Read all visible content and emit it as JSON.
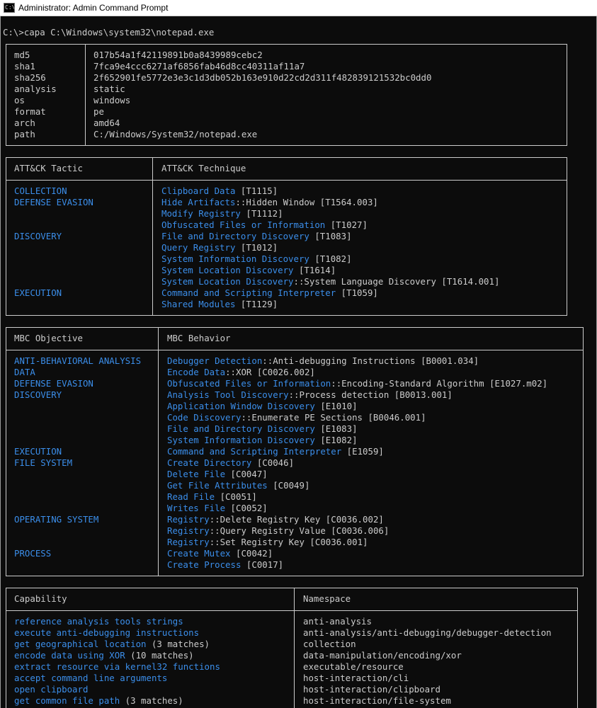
{
  "window": {
    "title": "Administrator: Admin Command Prompt",
    "icon_text": "C:\\"
  },
  "prompt": "C:\\>capa C:\\Windows\\system32\\notepad.exe",
  "colors": {
    "background": "#0c0c0c",
    "text": "#cccccc",
    "accent": "#3b8eea",
    "border": "#cccccc"
  },
  "meta": [
    {
      "key": "md5",
      "value": "017b54a1f42119891b0a8439989cebc2"
    },
    {
      "key": "sha1",
      "value": "7fca9e4ccc6271af6856fab46d8cc40311af11a7"
    },
    {
      "key": "sha256",
      "value": "2f652901fe5772e3e3c1d3db052b163e910d22cd2d311f482839121532bc0dd0"
    },
    {
      "key": "analysis",
      "value": "static"
    },
    {
      "key": "os",
      "value": "windows"
    },
    {
      "key": "format",
      "value": "pe"
    },
    {
      "key": "arch",
      "value": "amd64"
    },
    {
      "key": "path",
      "value": "C:/Windows/System32/notepad.exe"
    }
  ],
  "attack": {
    "headers": [
      "ATT&CK Tactic",
      "ATT&CK Technique"
    ],
    "rows": [
      {
        "left": "COLLECTION",
        "a": "Clipboard Data",
        "b": "",
        "c": " [T1115]"
      },
      {
        "left": "DEFENSE EVASION",
        "a": "Hide Artifacts",
        "b": "::Hidden Window",
        "c": " [T1564.003]"
      },
      {
        "left": "",
        "a": "Modify Registry",
        "b": "",
        "c": " [T1112]"
      },
      {
        "left": "",
        "a": "Obfuscated Files or Information",
        "b": "",
        "c": " [T1027]"
      },
      {
        "left": "DISCOVERY",
        "a": "File and Directory Discovery",
        "b": "",
        "c": " [T1083]"
      },
      {
        "left": "",
        "a": "Query Registry",
        "b": "",
        "c": " [T1012]"
      },
      {
        "left": "",
        "a": "System Information Discovery",
        "b": "",
        "c": " [T1082]"
      },
      {
        "left": "",
        "a": "System Location Discovery",
        "b": "",
        "c": " [T1614]"
      },
      {
        "left": "",
        "a": "System Location Discovery",
        "b": "::System Language Discovery",
        "c": " [T1614.001]"
      },
      {
        "left": "EXECUTION",
        "a": "Command and Scripting Interpreter",
        "b": "",
        "c": " [T1059]"
      },
      {
        "left": "",
        "a": "Shared Modules",
        "b": "",
        "c": " [T1129]"
      }
    ]
  },
  "mbc": {
    "headers": [
      "MBC Objective",
      "MBC Behavior"
    ],
    "rows": [
      {
        "left": "ANTI-BEHAVIORAL ANALYSIS",
        "a": "Debugger Detection",
        "b": "::Anti-debugging Instructions",
        "c": " [B0001.034]"
      },
      {
        "left": "DATA",
        "a": "Encode Data",
        "b": "::XOR",
        "c": " [C0026.002]"
      },
      {
        "left": "DEFENSE EVASION",
        "a": "Obfuscated Files or Information",
        "b": "::Encoding-Standard Algorithm",
        "c": " [E1027.m02]"
      },
      {
        "left": "DISCOVERY",
        "a": "Analysis Tool Discovery",
        "b": "::Process detection",
        "c": " [B0013.001]"
      },
      {
        "left": "",
        "a": "Application Window Discovery",
        "b": "",
        "c": " [E1010]"
      },
      {
        "left": "",
        "a": "Code Discovery",
        "b": "::Enumerate PE Sections",
        "c": " [B0046.001]"
      },
      {
        "left": "",
        "a": "File and Directory Discovery",
        "b": "",
        "c": " [E1083]"
      },
      {
        "left": "",
        "a": "System Information Discovery",
        "b": "",
        "c": " [E1082]"
      },
      {
        "left": "EXECUTION",
        "a": "Command and Scripting Interpreter",
        "b": "",
        "c": " [E1059]"
      },
      {
        "left": "FILE SYSTEM",
        "a": "Create Directory",
        "b": "",
        "c": " [C0046]"
      },
      {
        "left": "",
        "a": "Delete File",
        "b": "",
        "c": " [C0047]"
      },
      {
        "left": "",
        "a": "Get File Attributes",
        "b": "",
        "c": " [C0049]"
      },
      {
        "left": "",
        "a": "Read File",
        "b": "",
        "c": " [C0051]"
      },
      {
        "left": "",
        "a": "Writes File",
        "b": "",
        "c": " [C0052]"
      },
      {
        "left": "OPERATING SYSTEM",
        "a": "Registry",
        "b": "::Delete Registry Key",
        "c": " [C0036.002]"
      },
      {
        "left": "",
        "a": "Registry",
        "b": "::Query Registry Value",
        "c": " [C0036.006]"
      },
      {
        "left": "",
        "a": "Registry",
        "b": "::Set Registry Key",
        "c": " [C0036.001]"
      },
      {
        "left": "PROCESS",
        "a": "Create Mutex",
        "b": "",
        "c": " [C0042]"
      },
      {
        "left": "",
        "a": "Create Process",
        "b": "",
        "c": " [C0017]"
      }
    ]
  },
  "capabilities": {
    "headers": [
      "Capability",
      "Namespace"
    ],
    "rows": [
      {
        "name": "reference analysis tools strings",
        "suffix": "",
        "ns": "anti-analysis"
      },
      {
        "name": "execute anti-debugging instructions",
        "suffix": "",
        "ns": "anti-analysis/anti-debugging/debugger-detection"
      },
      {
        "name": "get geographical location",
        "suffix": " (3 matches)",
        "ns": "collection"
      },
      {
        "name": "encode data using XOR",
        "suffix": " (10 matches)",
        "ns": "data-manipulation/encoding/xor"
      },
      {
        "name": "extract resource via kernel32 functions",
        "suffix": "",
        "ns": "executable/resource"
      },
      {
        "name": "accept command line arguments",
        "suffix": "",
        "ns": "host-interaction/cli"
      },
      {
        "name": "open clipboard",
        "suffix": "",
        "ns": "host-interaction/clipboard"
      },
      {
        "name": "get common file path",
        "suffix": " (3 matches)",
        "ns": "host-interaction/file-system"
      }
    ]
  }
}
